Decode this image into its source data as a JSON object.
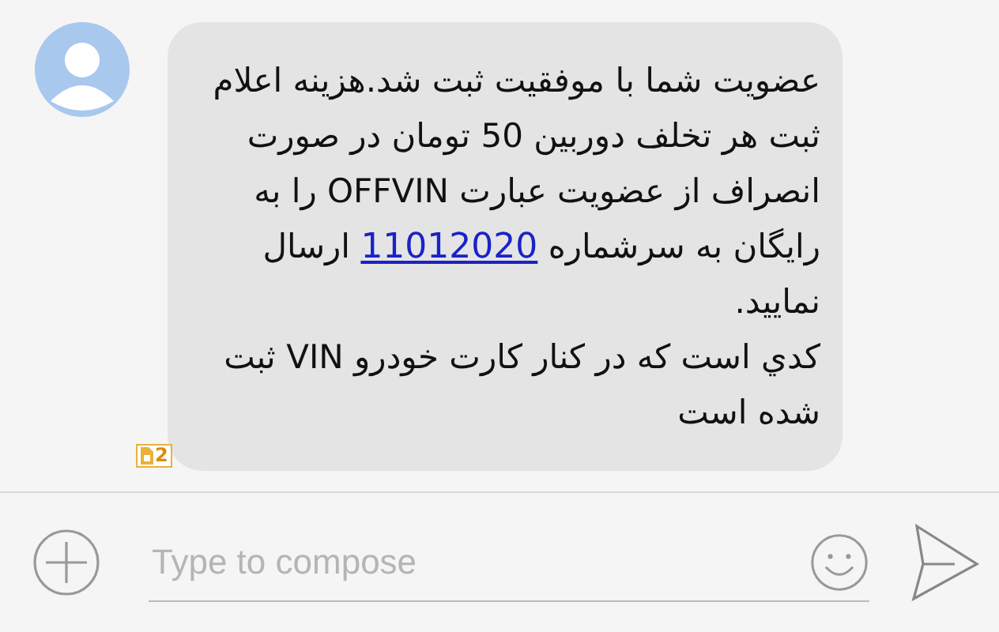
{
  "message": {
    "paragraphs": [
      {
        "segments": [
          {
            "kind": "text",
            "text": "عضویت شما با موفقیت ثبت شد.هزینه اعلام ثبت هر تخلف دوربین 50 تومان در صورت انصراف از عضویت عبارت OFFVIN را به رایگان به سرشماره "
          },
          {
            "kind": "link",
            "text": "11012020"
          },
          {
            "kind": "text",
            "text": " ارسال نمایید."
          }
        ]
      },
      {
        "segments": [
          {
            "kind": "text",
            "text": "كدي است كه در كنار كارت خودرو VIN ثبت شده است"
          }
        ]
      }
    ],
    "sim_badge": "2"
  },
  "composer": {
    "placeholder": "Type to compose"
  }
}
